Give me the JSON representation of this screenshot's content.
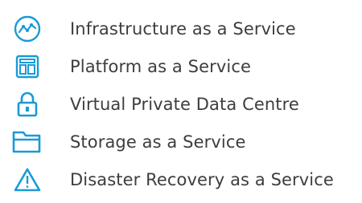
{
  "accent_color": "#1a9ad6",
  "text_color": "#3d3d3d",
  "services": [
    {
      "label": "Infrastructure as a Service",
      "icon": "line-chart-circle-icon"
    },
    {
      "label": "Platform as a Service",
      "icon": "layout-window-icon"
    },
    {
      "label": "Virtual Private Data Centre",
      "icon": "padlock-icon"
    },
    {
      "label": "Storage as a Service",
      "icon": "folder-open-icon"
    },
    {
      "label": "Disaster Recovery as a Service",
      "icon": "warning-triangle-icon"
    }
  ]
}
